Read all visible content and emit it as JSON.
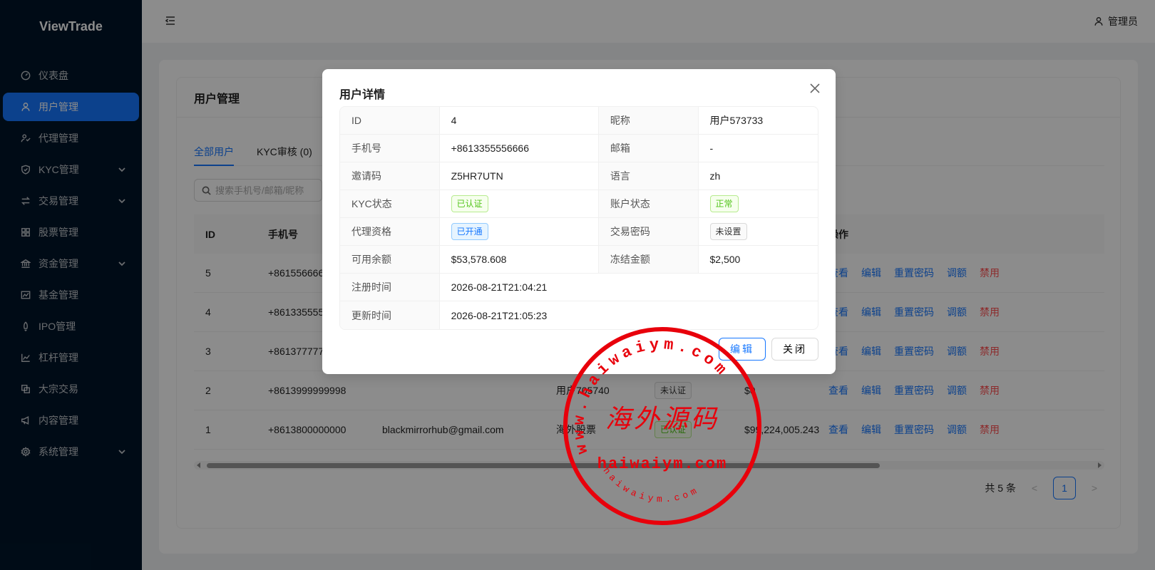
{
  "app": {
    "title": "ViewTrade"
  },
  "sidebar": {
    "items": [
      {
        "label": "仪表盘",
        "icon": "dashboard-icon",
        "active": false,
        "submenu": false
      },
      {
        "label": "用户管理",
        "icon": "user-icon",
        "active": true,
        "submenu": false
      },
      {
        "label": "代理管理",
        "icon": "team-icon",
        "active": false,
        "submenu": false
      },
      {
        "label": "KYC管理",
        "icon": "shield-icon",
        "active": false,
        "submenu": true
      },
      {
        "label": "交易管理",
        "icon": "swap-icon",
        "active": false,
        "submenu": true
      },
      {
        "label": "股票管理",
        "icon": "grid-icon",
        "active": false,
        "submenu": false
      },
      {
        "label": "资金管理",
        "icon": "bank-icon",
        "active": false,
        "submenu": true
      },
      {
        "label": "基金管理",
        "icon": "fund-icon",
        "active": false,
        "submenu": false
      },
      {
        "label": "IPO管理",
        "icon": "rocket-icon",
        "active": false,
        "submenu": false
      },
      {
        "label": "杠杆管理",
        "icon": "line-chart-icon",
        "active": false,
        "submenu": false
      },
      {
        "label": "大宗交易",
        "icon": "block-icon",
        "active": false,
        "submenu": false
      },
      {
        "label": "内容管理",
        "icon": "megaphone-icon",
        "active": false,
        "submenu": false
      },
      {
        "label": "系统管理",
        "icon": "gear-icon",
        "active": false,
        "submenu": true
      }
    ]
  },
  "header": {
    "user_label": "管理员"
  },
  "page": {
    "title": "用户管理",
    "tabs": [
      {
        "label": "全部用户",
        "active": true
      },
      {
        "label": "KYC审核 (0)",
        "active": false
      }
    ],
    "search": {
      "placeholder": "搜索手机号/邮箱/昵称"
    },
    "table": {
      "columns": {
        "id": "ID",
        "phone": "手机号",
        "ops": "操作"
      },
      "rows": [
        {
          "id": "5",
          "phone": "+861556666",
          "email": "",
          "nickname": "",
          "kyc": "",
          "balance": ""
        },
        {
          "id": "4",
          "phone": "+861335555",
          "email": "",
          "nickname": "",
          "kyc": "",
          "balance": ""
        },
        {
          "id": "3",
          "phone": "+861377777",
          "email": "",
          "nickname": "",
          "kyc": "",
          "balance": ""
        },
        {
          "id": "2",
          "phone": "+8613999999998",
          "email": "",
          "nickname": "用户705740",
          "kyc": "未认证",
          "balance": "$0"
        },
        {
          "id": "1",
          "phone": "+8613800000000",
          "email": "blackmirrorhub@gmail.com",
          "nickname": "海外股票",
          "kyc": "已认证",
          "balance": "$99,224,005.243"
        }
      ],
      "actions": {
        "view": "查看",
        "edit": "编辑",
        "reset": "重置密码",
        "adjust": "调额",
        "disable": "禁用"
      }
    },
    "pagination": {
      "total_label": "共 5 条",
      "prev": "<",
      "current": "1",
      "next": ">"
    }
  },
  "modal": {
    "title": "用户详情",
    "fields": {
      "id_label": "ID",
      "id": "4",
      "nickname_label": "昵称",
      "nickname": "用户573733",
      "phone_label": "手机号",
      "phone": "+8613355556666",
      "email_label": "邮箱",
      "email": "-",
      "invite_label": "邀请码",
      "invite": "Z5HR7UTN",
      "lang_label": "语言",
      "lang": "zh",
      "kyc_label": "KYC状态",
      "kyc": "已认证",
      "account_label": "账户状态",
      "account": "正常",
      "agent_label": "代理资格",
      "agent": "已开通",
      "tradepw_label": "交易密码",
      "tradepw": "未设置",
      "available_label": "可用余额",
      "available": "$53,578.608",
      "frozen_label": "冻结金额",
      "frozen": "$2,500",
      "created_label": "注册时间",
      "created": "2026-08-21T21:04:21",
      "updated_label": "更新时间",
      "updated": "2026-08-21T21:05:23"
    },
    "edit_button": "编辑",
    "close_button": "关闭"
  },
  "watermark": {
    "text_arc": "www.haiwaiym.com",
    "text_center": "海外源码",
    "text_url": "haiwaiym.com",
    "text_bottom": "haiwaiym.com",
    "color": "#e8000b"
  },
  "colors": {
    "primary": "#1677ff",
    "sidebar": "#001529",
    "danger": "#ff4d4f",
    "success": "#52c41a"
  }
}
